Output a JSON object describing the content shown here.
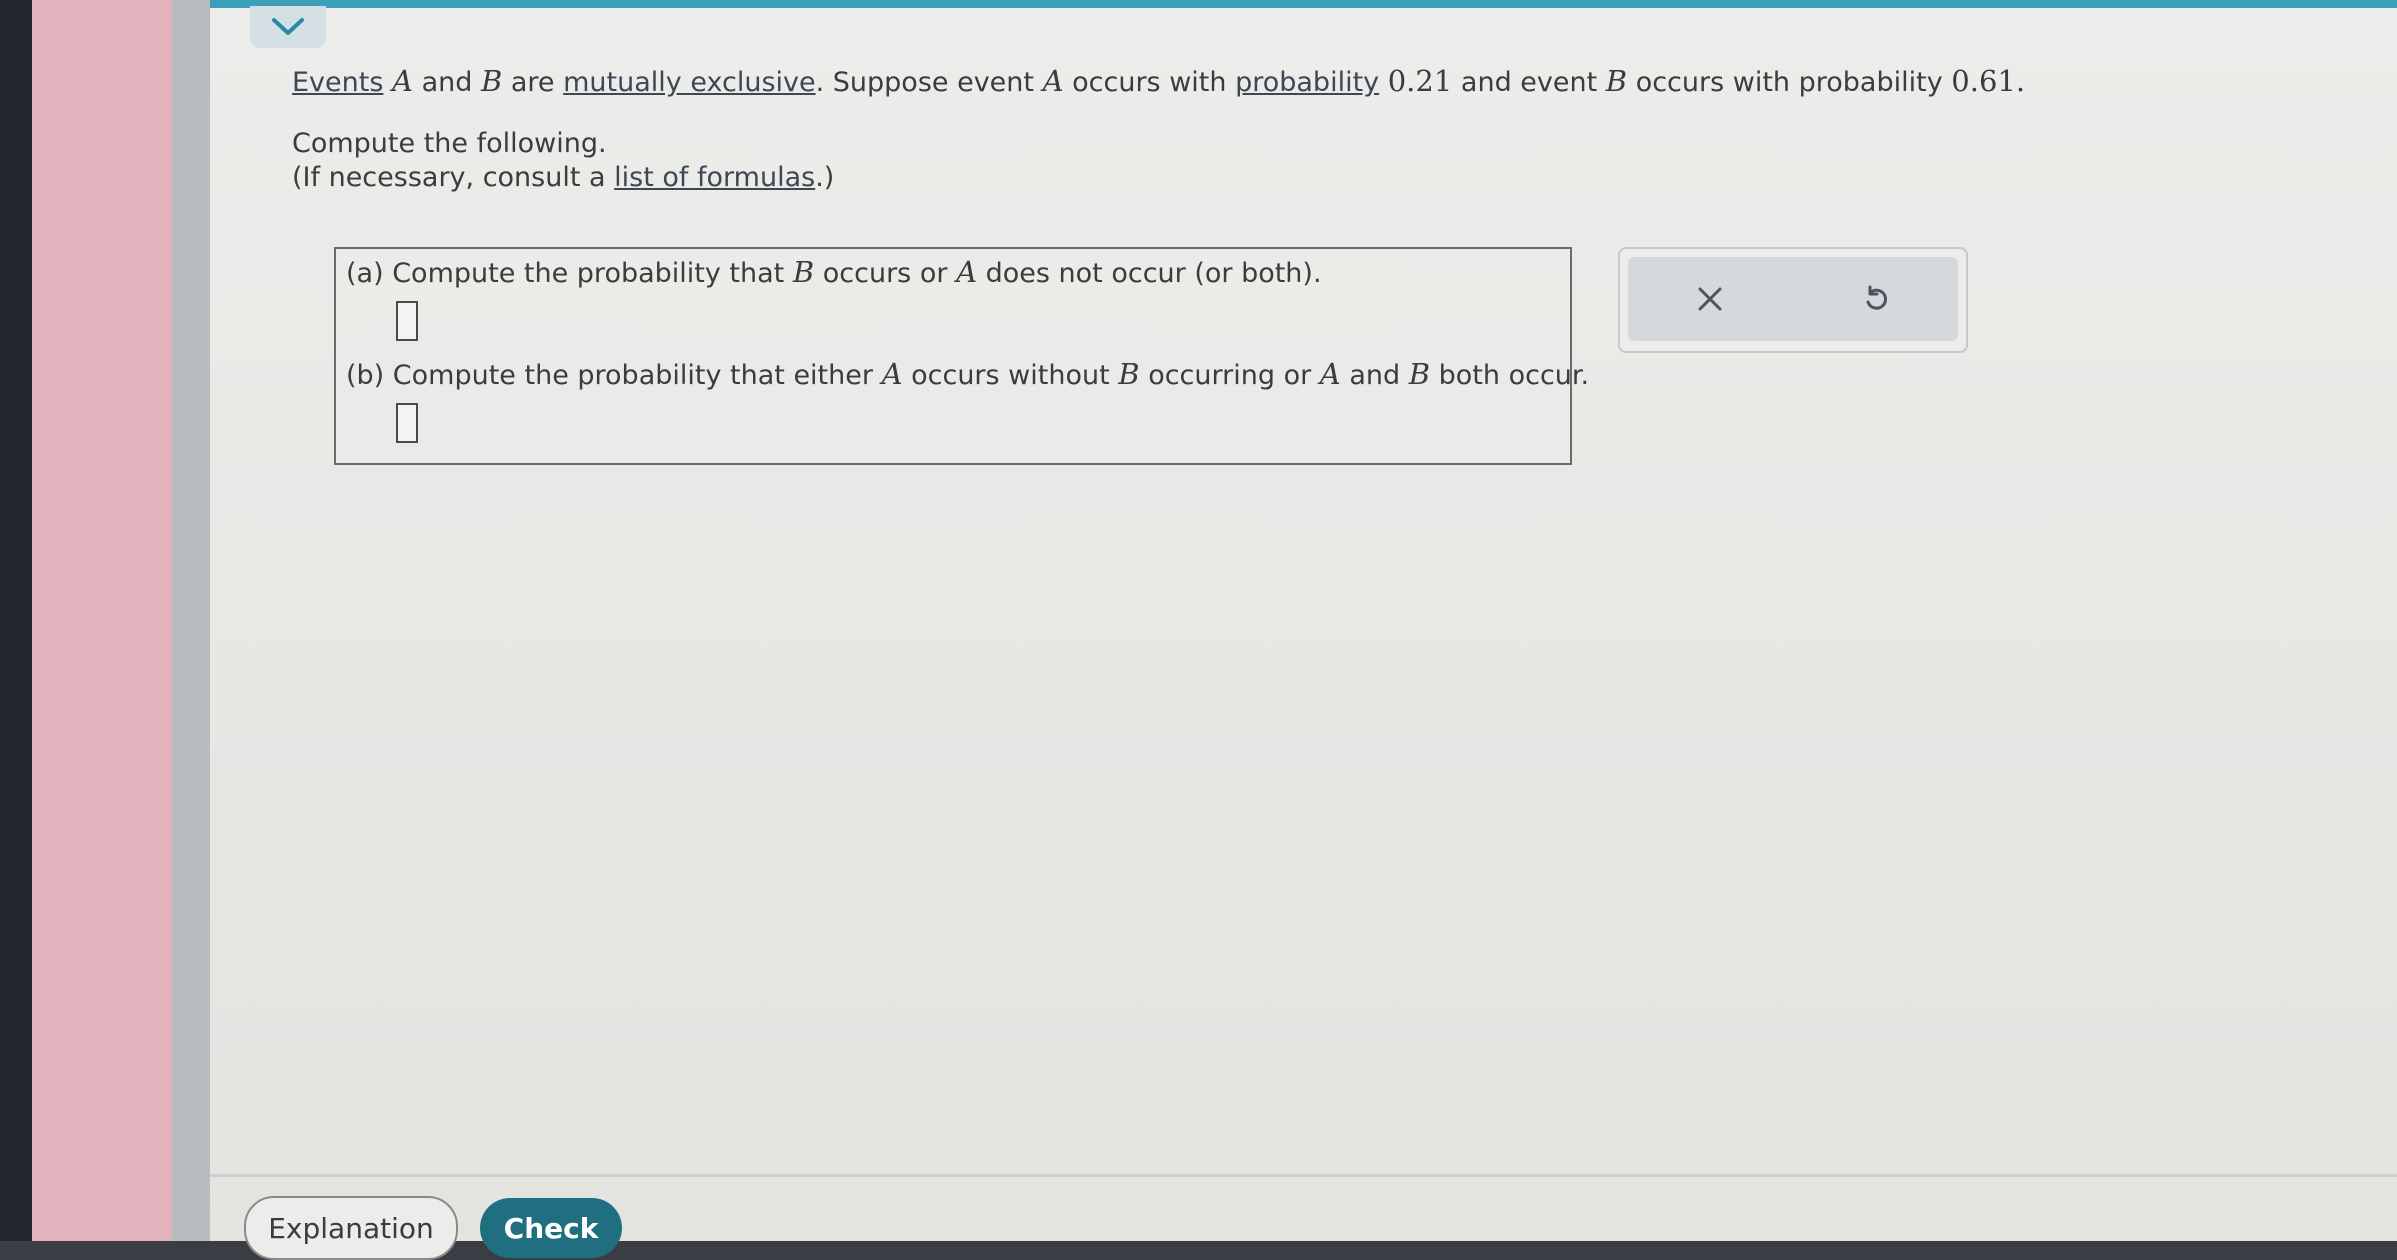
{
  "question": {
    "events_link": "Events",
    "event_a": "A",
    "text_and": "and",
    "event_b": "B",
    "text_are": "are",
    "mutually_exclusive_link": "mutually exclusive",
    "text_suppose": ". Suppose event",
    "event_a2": "A",
    "text_occurs_with": "occurs with",
    "probability_link": "probability",
    "prob_a": "0.21",
    "text_and_event": "and event",
    "event_b2": "B",
    "text_occurs_with_probability": "occurs with probability",
    "prob_b": "0.61",
    "period": "."
  },
  "instructions": {
    "compute_line": "Compute the following.",
    "consult_prefix": "(If necessary, consult a",
    "formulas_link": "list of formulas",
    "consult_suffix": ".)"
  },
  "part_a": {
    "prefix": "(a) Compute the probability that",
    "var_b": "B",
    "middle": "occurs or",
    "var_a": "A",
    "suffix": "does not occur (or both)."
  },
  "part_b": {
    "prefix": "(b) Compute the probability that either",
    "var_a": "A",
    "middle1": "occurs without",
    "var_b": "B",
    "middle2": "occurring or",
    "var_a2": "A",
    "middle3": "and",
    "var_b2": "B",
    "suffix": "both occur."
  },
  "actions": {
    "clear_icon": "x-icon",
    "undo_icon": "undo-icon"
  },
  "footer": {
    "explanation_label": "Explanation",
    "check_label": "Check"
  },
  "colors": {
    "accent": "#3aa0b8",
    "check_button": "#1f6f80"
  }
}
